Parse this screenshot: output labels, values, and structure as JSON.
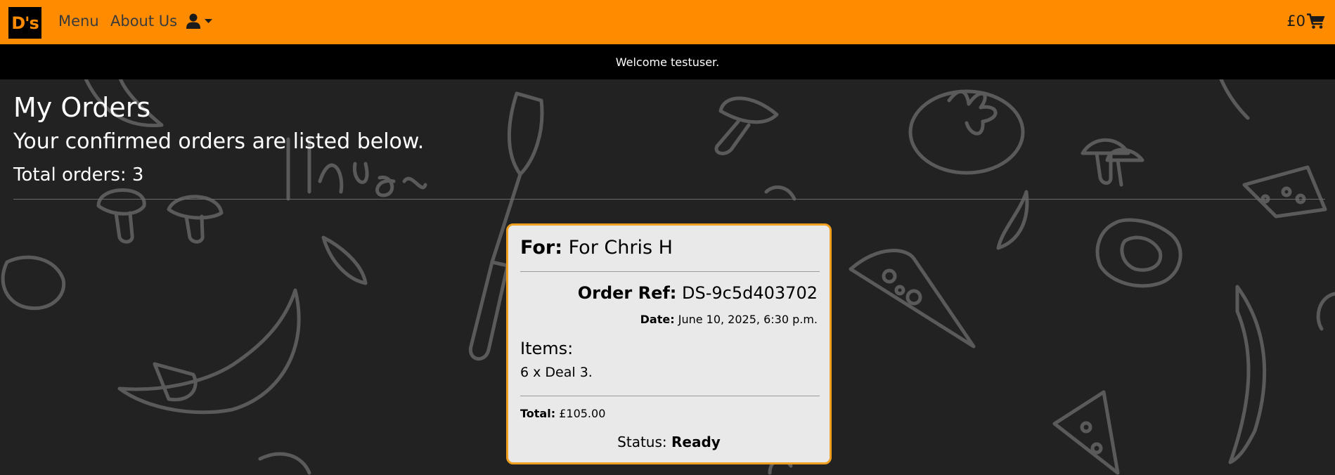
{
  "navbar": {
    "logo_text": "D's",
    "menu_label": "Menu",
    "about_label": "About Us",
    "user_icon": "user-icon",
    "cart_total": "£0",
    "cart_icon": "cart-icon",
    "accent_color": "#ff8c00"
  },
  "welcome": {
    "message": "Welcome testuser."
  },
  "page": {
    "title": "My Orders",
    "subtitle": "Your confirmed orders are listed below.",
    "total_orders": "Total orders: 3"
  },
  "order": {
    "for_label": "For:",
    "for_value": "For Chris H",
    "ref_label": "Order Ref:",
    "ref_value": "DS-9c5d403702",
    "date_label": "Date:",
    "date_value": "June 10, 2025, 6:30 p.m.",
    "items_heading": "Items:",
    "items_value": "6 x Deal 3.",
    "total_label": "Total:",
    "total_value": "£105.00",
    "status_label": "Status:",
    "status_value": "Ready",
    "border_color": "#f0a020"
  }
}
